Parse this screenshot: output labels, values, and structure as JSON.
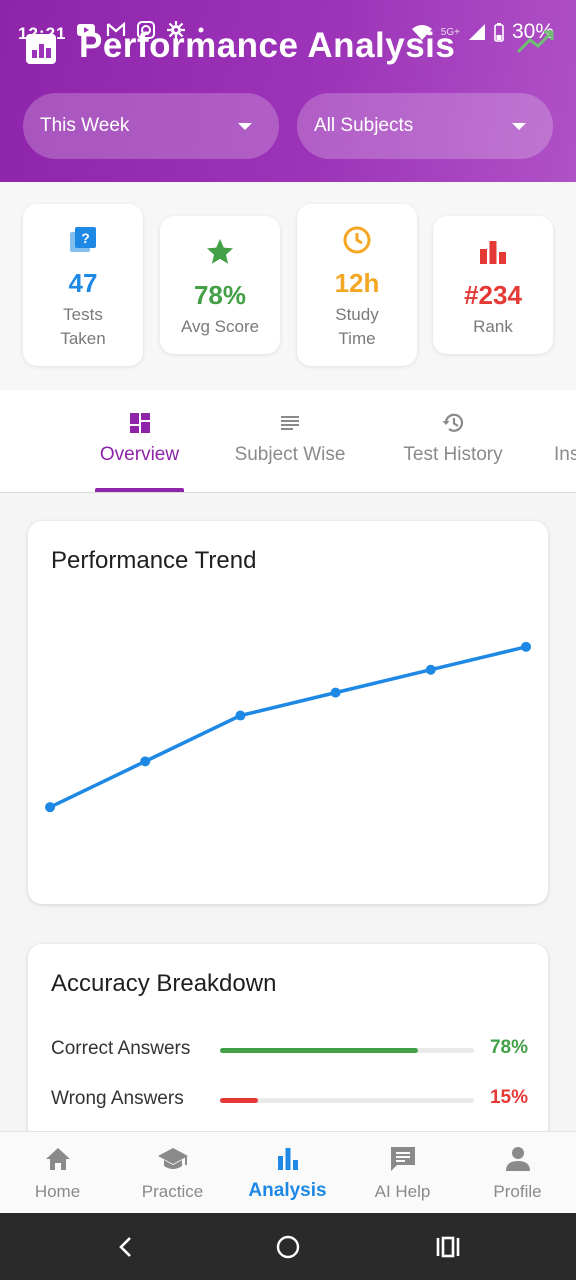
{
  "status_bar": {
    "time": "12:21",
    "battery": "30%",
    "network": "5G+"
  },
  "header": {
    "title": "Performance Analysis",
    "period_dropdown": "This Week",
    "subject_dropdown": "All Subjects"
  },
  "stats": [
    {
      "value": "47",
      "label_line1": "Tests",
      "label_line2": "Taken",
      "icon": "quiz-icon",
      "color": "#1e88e5"
    },
    {
      "value": "78%",
      "label_line1": "Avg Score",
      "label_line2": "",
      "icon": "star-icon",
      "color": "#43a047"
    },
    {
      "value": "12h",
      "label_line1": "Study",
      "label_line2": "Time",
      "icon": "clock-icon",
      "color": "#f5a623"
    },
    {
      "value": "#234",
      "label_line1": "Rank",
      "label_line2": "",
      "icon": "bar-chart-icon",
      "color": "#e53935"
    }
  ],
  "tabs": [
    {
      "label": "Overview",
      "icon": "dashboard-icon",
      "active": true
    },
    {
      "label": "Subject Wise",
      "icon": "list-icon",
      "active": false
    },
    {
      "label": "Test History",
      "icon": "history-icon",
      "active": false
    },
    {
      "label": "Ins",
      "icon": "",
      "active": false
    }
  ],
  "performance_trend": {
    "title": "Performance Trend",
    "chart_data": {
      "type": "line",
      "x": [
        1,
        2,
        3,
        4,
        5,
        6
      ],
      "values": [
        50,
        60,
        70,
        75,
        80,
        85
      ],
      "ylim": [
        40,
        95
      ],
      "grid": false,
      "color": "#1e88e5"
    }
  },
  "accuracy": {
    "title": "Accuracy Breakdown",
    "rows": [
      {
        "label": "Correct Answers",
        "value": "78%",
        "fraction": 0.78,
        "color": "#43a047"
      },
      {
        "label": "Wrong Answers",
        "value": "15%",
        "fraction": 0.15,
        "color": "#e53935"
      }
    ]
  },
  "bottom_nav": [
    {
      "label": "Home",
      "icon": "home-icon",
      "active": false
    },
    {
      "label": "Practice",
      "icon": "graduation-cap-icon",
      "active": false
    },
    {
      "label": "Analysis",
      "icon": "bar-chart-icon",
      "active": true
    },
    {
      "label": "AI Help",
      "icon": "chat-icon",
      "active": false
    },
    {
      "label": "Profile",
      "icon": "person-icon",
      "active": false
    }
  ],
  "colors": {
    "brand": "#8e24aa",
    "accent": "#1e88e5"
  }
}
